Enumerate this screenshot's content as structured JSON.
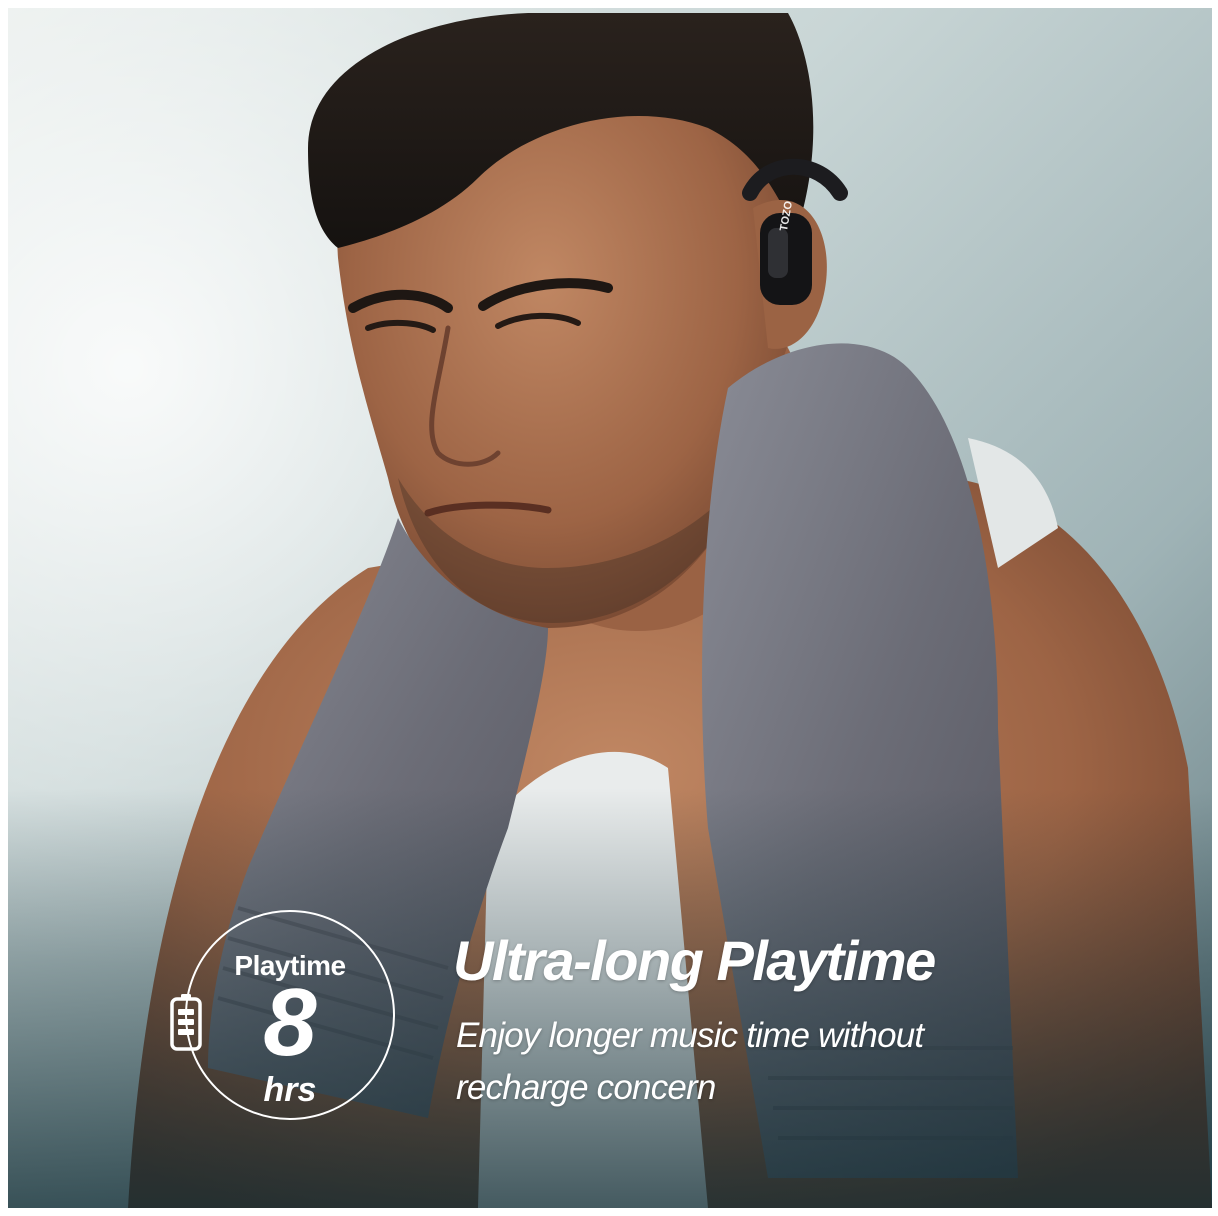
{
  "badge": {
    "label": "Playtime",
    "value": "8",
    "unit": "hrs",
    "icon": "battery-icon"
  },
  "headline": "Ultra-long Playtime",
  "description": "Enjoy longer music time without recharge concern",
  "product": {
    "brand_on_earbud": "TOZO"
  },
  "colors": {
    "text": "#ffffff",
    "towel": "#6f7078",
    "skin": "#a86c4c",
    "background": "#b8c7ca"
  }
}
